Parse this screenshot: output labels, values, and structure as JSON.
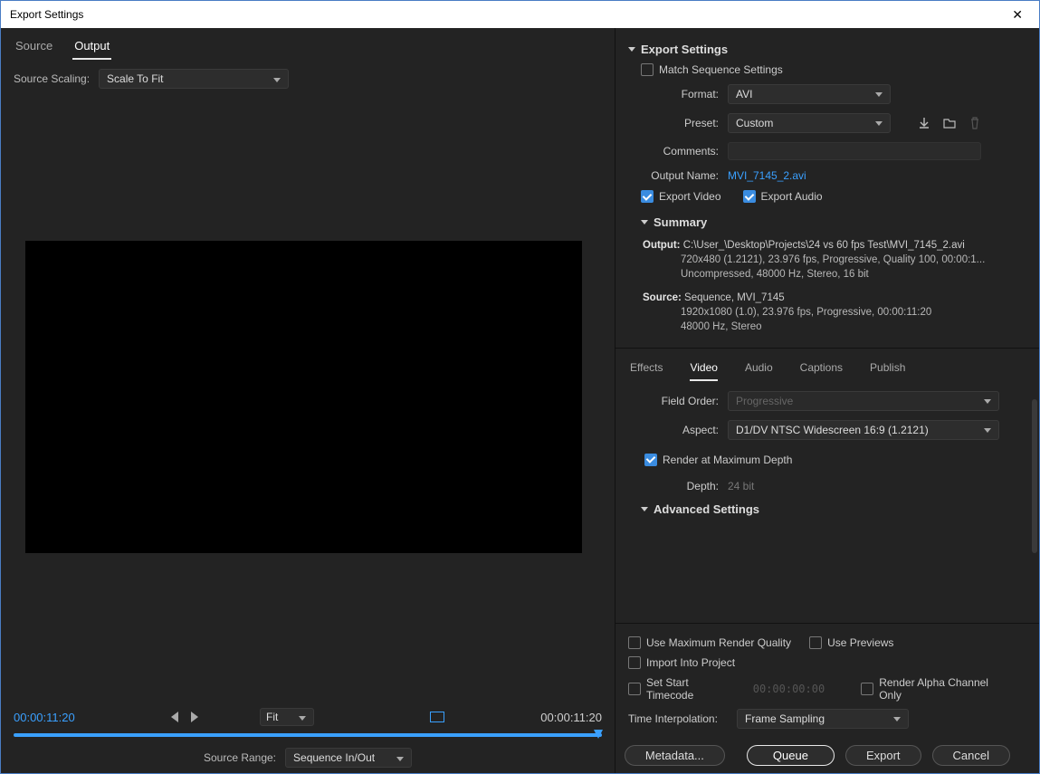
{
  "title": "Export Settings",
  "leftTabs": {
    "source": "Source",
    "output": "Output"
  },
  "sourceScaling": {
    "label": "Source Scaling:",
    "value": "Scale To Fit"
  },
  "fitSelect": "Fit",
  "times": {
    "left": "00:00:11:20",
    "right": "00:00:11:20"
  },
  "sourceRange": {
    "label": "Source Range:",
    "value": "Sequence In/Out"
  },
  "sections": {
    "export": "Export Settings",
    "summary": "Summary",
    "advanced": "Advanced Settings"
  },
  "matchSeq": "Match Sequence Settings",
  "format": {
    "label": "Format:",
    "value": "AVI"
  },
  "preset": {
    "label": "Preset:",
    "value": "Custom"
  },
  "comments": {
    "label": "Comments:"
  },
  "outputName": {
    "label": "Output Name:",
    "value": "MVI_7145_2.avi"
  },
  "exportVideo": "Export Video",
  "exportAudio": "Export Audio",
  "summary": {
    "output_label": "Output:",
    "output_path": "C:\\User_\\Desktop\\Projects\\24 vs 60 fps Test\\MVI_7145_2.avi",
    "output_l2": "720x480 (1.2121), 23.976 fps, Progressive, Quality 100, 00:00:1...",
    "output_l3": "Uncompressed, 48000 Hz, Stereo, 16 bit",
    "source_label": "Source:",
    "source_path": "Sequence, MVI_7145",
    "source_l2": "1920x1080 (1.0), 23.976 fps, Progressive, 00:00:11:20",
    "source_l3": "48000 Hz, Stereo"
  },
  "rightTabs": {
    "effects": "Effects",
    "video": "Video",
    "audio": "Audio",
    "captions": "Captions",
    "publish": "Publish"
  },
  "fieldOrder": {
    "label": "Field Order:",
    "value": "Progressive"
  },
  "aspect": {
    "label": "Aspect:",
    "value": "D1/DV NTSC Widescreen 16:9 (1.2121)"
  },
  "maxDepth": "Render at Maximum Depth",
  "depth": {
    "label": "Depth:",
    "value": "24 bit"
  },
  "bottom": {
    "maxQuality": "Use Maximum Render Quality",
    "previews": "Use Previews",
    "import": "Import Into Project",
    "setStart": "Set Start Timecode",
    "startTC": "00:00:00:00",
    "alpha": "Render Alpha Channel Only",
    "timeInterp": {
      "label": "Time Interpolation:",
      "value": "Frame Sampling"
    }
  },
  "buttons": {
    "metadata": "Metadata...",
    "queue": "Queue",
    "export": "Export",
    "cancel": "Cancel"
  }
}
